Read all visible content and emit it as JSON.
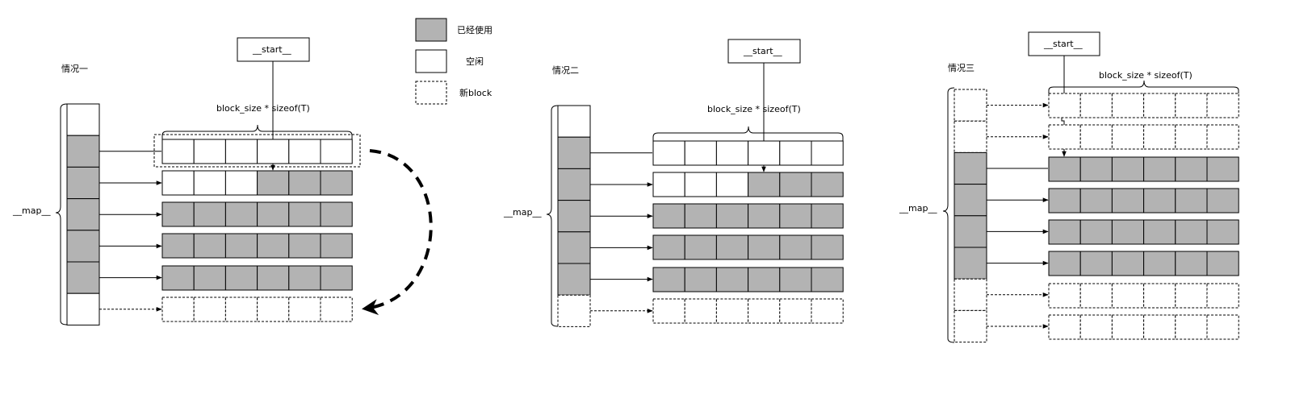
{
  "legend": {
    "used": "已经使用",
    "free": "空闲",
    "new_block": "新block"
  },
  "colors": {
    "used": "#b3b3b3",
    "free": "#ffffff",
    "stroke": "#000000"
  },
  "scenarios": [
    {
      "title": "情况一",
      "start_label": "__start__",
      "brace_label": "block_size * sizeof(T)",
      "map_label": "__map__",
      "map_cells": [
        "free",
        "used",
        "used",
        "used",
        "used",
        "used",
        "free"
      ],
      "rows": [
        [
          "free",
          "free",
          "free",
          "free",
          "free",
          "free"
        ],
        [
          "free",
          "free",
          "free",
          "used",
          "used",
          "used"
        ],
        [
          "used",
          "used",
          "used",
          "used",
          "used",
          "used"
        ],
        [
          "used",
          "used",
          "used",
          "used",
          "used",
          "used"
        ],
        [
          "used",
          "used",
          "used",
          "used",
          "used",
          "used"
        ],
        [
          "new",
          "new",
          "new",
          "new",
          "new",
          "new"
        ]
      ]
    },
    {
      "title": "情况二",
      "start_label": "__start__",
      "brace_label": "block_size * sizeof(T)",
      "map_label": "__map__",
      "map_cells": [
        "free",
        "used",
        "used",
        "used",
        "used",
        "used",
        "new"
      ],
      "rows": [
        [
          "free",
          "free",
          "free",
          "free",
          "free",
          "free"
        ],
        [
          "free",
          "free",
          "free",
          "used",
          "used",
          "used"
        ],
        [
          "used",
          "used",
          "used",
          "used",
          "used",
          "used"
        ],
        [
          "used",
          "used",
          "used",
          "used",
          "used",
          "used"
        ],
        [
          "used",
          "used",
          "used",
          "used",
          "used",
          "used"
        ],
        [
          "new",
          "new",
          "new",
          "new",
          "new",
          "new"
        ]
      ]
    },
    {
      "title": "情况三",
      "start_label": "__start__",
      "brace_label": "block_size * sizeof(T)",
      "map_label": "__map__",
      "map_cells": [
        "new",
        "new",
        "used",
        "used",
        "used",
        "used",
        "new",
        "new"
      ],
      "rows": [
        [
          "new",
          "new",
          "new",
          "new",
          "new",
          "new"
        ],
        [
          "new",
          "new",
          "new",
          "new",
          "new",
          "new"
        ],
        [
          "used",
          "used",
          "used",
          "used",
          "used",
          "used"
        ],
        [
          "used",
          "used",
          "used",
          "used",
          "used",
          "used"
        ],
        [
          "used",
          "used",
          "used",
          "used",
          "used",
          "used"
        ],
        [
          "used",
          "used",
          "used",
          "used",
          "used",
          "used"
        ],
        [
          "new",
          "new",
          "new",
          "new",
          "new",
          "new"
        ],
        [
          "new",
          "new",
          "new",
          "new",
          "new",
          "new"
        ]
      ]
    }
  ]
}
